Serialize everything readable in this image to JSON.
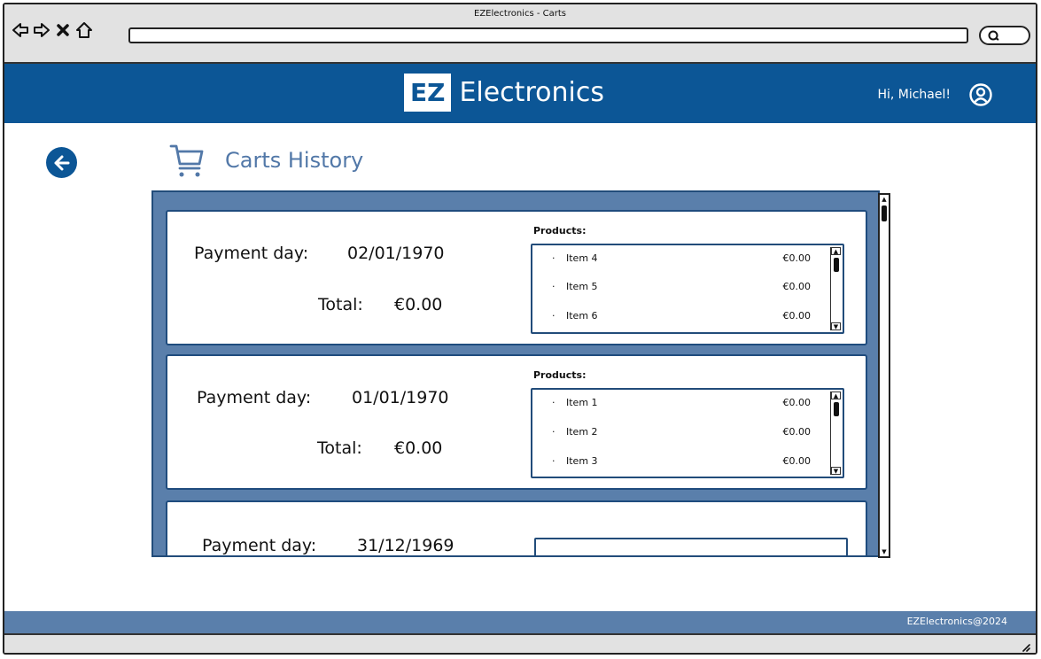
{
  "browser": {
    "window_title": "EZElectronics - Carts",
    "url": ""
  },
  "header": {
    "logo_badge": "EZ",
    "logo_text": "Electronics",
    "greeting": "Hi, Michael!"
  },
  "page": {
    "title": "Carts History"
  },
  "labels": {
    "payment_day": "Payment day:",
    "total": "Total:",
    "products": "Products:"
  },
  "carts": [
    {
      "payment_day": "02/01/1970",
      "total": "€0.00",
      "items": [
        {
          "bullet": "·",
          "name": "Item 4",
          "price": "€0.00"
        },
        {
          "bullet": "·",
          "name": "Item 5",
          "price": "€0.00"
        },
        {
          "bullet": "·",
          "name": "Item 6",
          "price": "€0.00"
        }
      ]
    },
    {
      "payment_day": "01/01/1970",
      "total": "€0.00",
      "items": [
        {
          "bullet": "·",
          "name": "Item 1",
          "price": "€0.00"
        },
        {
          "bullet": "·",
          "name": "Item 2",
          "price": "€0.00"
        },
        {
          "bullet": "·",
          "name": "Item 3",
          "price": "€0.00"
        }
      ]
    },
    {
      "payment_day": "31/12/1969"
    }
  ],
  "footer": {
    "text": "EZElectronics@2024"
  },
  "colors": {
    "brand_blue": "#0c5696",
    "panel_blue": "#5a7fab",
    "title_blue": "#5278a8"
  }
}
